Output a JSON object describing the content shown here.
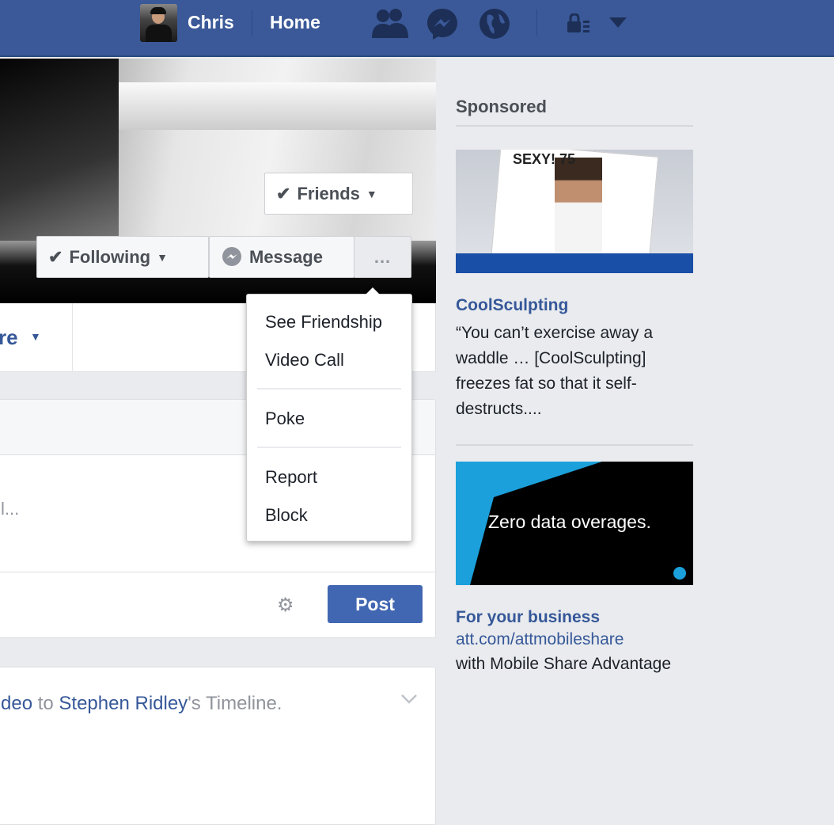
{
  "topbar": {
    "user_name": "Chris",
    "home_label": "Home",
    "icons": [
      "friend-requests-icon",
      "messenger-icon",
      "notifications-globe-icon",
      "privacy-lock-icon",
      "account-menu-caret-icon"
    ]
  },
  "profile": {
    "friends_label": "Friends",
    "following_label": "Following",
    "message_label": "Message",
    "more_label": "...",
    "tab_partial": "re"
  },
  "menu": {
    "items": [
      "See Friendship",
      "Video Call",
      "Poke",
      "Report",
      "Block"
    ]
  },
  "composer": {
    "placeholder_partial": "l...",
    "post_label": "Post"
  },
  "feed": {
    "story_parts": [
      "deo",
      " to ",
      "Stephen Ridley",
      "'s Timeline."
    ]
  },
  "sponsored": {
    "heading": "Sponsored",
    "ads": [
      {
        "title": "CoolSculpting",
        "body": "“You can’t exercise away a waddle … [CoolSculpting] freezes fat so that it self-destructs....",
        "image_text": "SEXY! 75"
      },
      {
        "title": "For your business",
        "url": "att.com/attmobileshare",
        "body": "with Mobile Share Advantage",
        "image_text": "Zero data overages."
      }
    ]
  },
  "colors": {
    "brand": "#3b5998",
    "link": "#365899",
    "post_button": "#4267b2"
  }
}
